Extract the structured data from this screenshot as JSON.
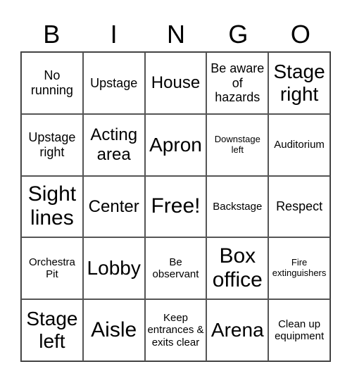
{
  "header": {
    "letters": [
      "B",
      "I",
      "N",
      "G",
      "O"
    ]
  },
  "cells": [
    "No running",
    "Upstage",
    "House",
    "Be aware of hazards",
    "Stage right",
    "Upstage right",
    "Acting area",
    "Apron",
    "Downstage left",
    "Auditorium",
    "Sight lines",
    "Center",
    "Free!",
    "Backstage",
    "Respect",
    "Orchestra Pit",
    "Lobby",
    "Be observant",
    "Box office",
    "Fire extinguishers",
    "Stage left",
    "Aisle",
    "Keep entrances & exits clear",
    "Arena",
    "Clean up equipment"
  ]
}
